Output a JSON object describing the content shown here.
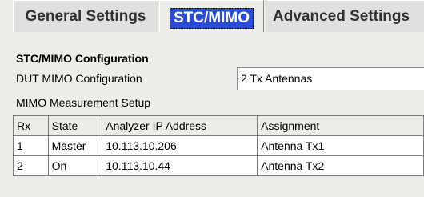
{
  "tabs": [
    {
      "label": "General Settings"
    },
    {
      "label": "STC/MIMO"
    },
    {
      "label": "Advanced Settings"
    }
  ],
  "section_title": "STC/MIMO Configuration",
  "dut_config": {
    "label": "DUT MIMO Configuration",
    "value": "2 Tx Antennas"
  },
  "measurement_setup_label": "MIMO Measurement Setup",
  "table": {
    "headers": [
      "Rx",
      "State",
      "Analyzer IP Address",
      "Assignment"
    ],
    "rows": [
      [
        "1",
        "Master",
        "10.113.10.206",
        "Antenna Tx1"
      ],
      [
        "2",
        "On",
        "10.113.10.44",
        "Antenna Tx2"
      ]
    ]
  },
  "colors": {
    "selected_tab": "#2a4bd7",
    "background": "#ecece8"
  }
}
